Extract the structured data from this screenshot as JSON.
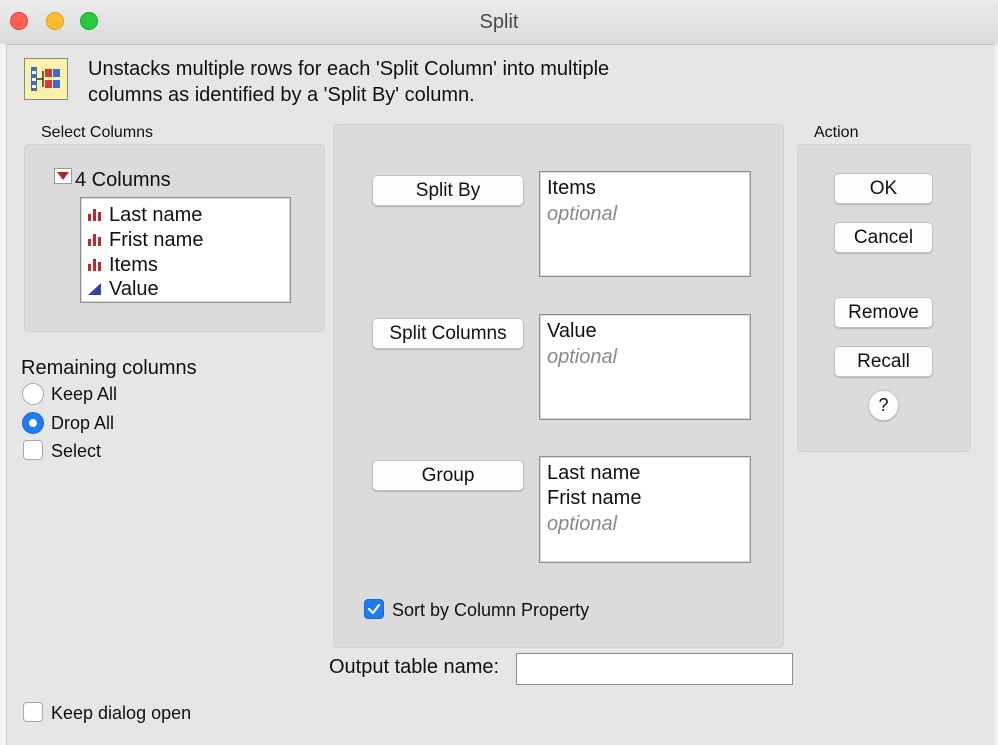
{
  "window": {
    "title": "Split"
  },
  "header": {
    "description_line1": "Unstacks multiple rows for each 'Split Column' into multiple",
    "description_line2": "columns as identified by a 'Split By' column."
  },
  "select_columns": {
    "label": "Select Columns",
    "count_label": "4 Columns",
    "items": [
      {
        "name": "Last name",
        "icon": "nominal-bar-icon"
      },
      {
        "name": "Frist name",
        "icon": "nominal-bar-icon"
      },
      {
        "name": "Items",
        "icon": "nominal-bar-icon"
      },
      {
        "name": "Value",
        "icon": "continuous-triangle-icon"
      }
    ]
  },
  "remaining_columns": {
    "label": "Remaining columns",
    "options": [
      {
        "label": "Keep All",
        "selected": false
      },
      {
        "label": "Drop All",
        "selected": true
      },
      {
        "label": "Select",
        "selected": false
      }
    ]
  },
  "roles": {
    "split_by": {
      "button": "Split By",
      "values": [
        "Items"
      ],
      "placeholder": "optional"
    },
    "split_columns": {
      "button": "Split Columns",
      "values": [
        "Value"
      ],
      "placeholder": "optional"
    },
    "group": {
      "button": "Group",
      "values": [
        "Last name",
        "Frist name"
      ],
      "placeholder": "optional"
    }
  },
  "sort_by_column_property": {
    "label": "Sort by Column Property",
    "checked": true
  },
  "output_table": {
    "label": "Output table name:",
    "value": ""
  },
  "action": {
    "label": "Action",
    "ok": "OK",
    "cancel": "Cancel",
    "remove": "Remove",
    "recall": "Recall",
    "help": "?"
  },
  "keep_dialog_open": {
    "label": "Keep dialog open",
    "checked": false
  },
  "colors": {
    "accent": "#1d7cf2",
    "close": "#fe5f57",
    "minimize": "#febc2e",
    "zoom": "#28c840"
  }
}
